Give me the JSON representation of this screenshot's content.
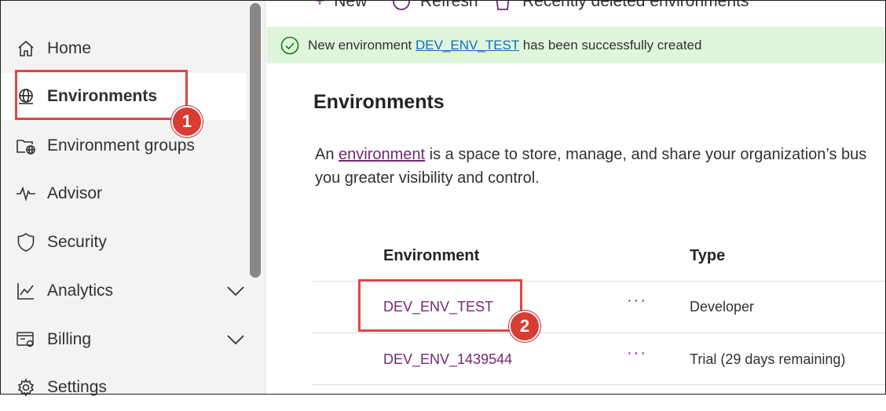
{
  "sidebar": {
    "items": [
      {
        "label": "Home",
        "icon": "home-icon"
      },
      {
        "label": "Environments",
        "icon": "globe-icon",
        "active": true
      },
      {
        "label": "Environment groups",
        "icon": "folder-globe-icon"
      },
      {
        "label": "Advisor",
        "icon": "pulse-icon"
      },
      {
        "label": "Security",
        "icon": "shield-icon"
      },
      {
        "label": "Analytics",
        "icon": "chart-icon",
        "expandable": true
      },
      {
        "label": "Billing",
        "icon": "billing-icon",
        "expandable": true
      },
      {
        "label": "Settings",
        "icon": "gear-icon"
      }
    ]
  },
  "toolbar": {
    "new_label": "New",
    "refresh_label": "Refresh",
    "recently_deleted_label": "Recently deleted environments"
  },
  "banner": {
    "prefix": "New environment ",
    "env_link": "DEV_ENV_TEST",
    "suffix": " has been successfully created"
  },
  "main": {
    "title": "Environments",
    "desc_prefix": "An ",
    "desc_link": "environment",
    "desc_line1_rest": " is a space to store, manage, and share your organization’s bus",
    "desc_line2": "you greater visibility and control."
  },
  "table": {
    "headers": {
      "environment": "Environment",
      "type": "Type"
    },
    "rows": [
      {
        "environment": "DEV_ENV_TEST",
        "more": "···",
        "type": "Developer"
      },
      {
        "environment": "DEV_ENV_1439544",
        "more": "···",
        "type": "Trial (29 days remaining)"
      }
    ]
  },
  "annotations": {
    "step1": "1",
    "step2": "2"
  },
  "colors": {
    "accent": "#742774",
    "success_bg": "#dff6dd",
    "highlight": "#e04545",
    "link": "#0f6cbd"
  }
}
